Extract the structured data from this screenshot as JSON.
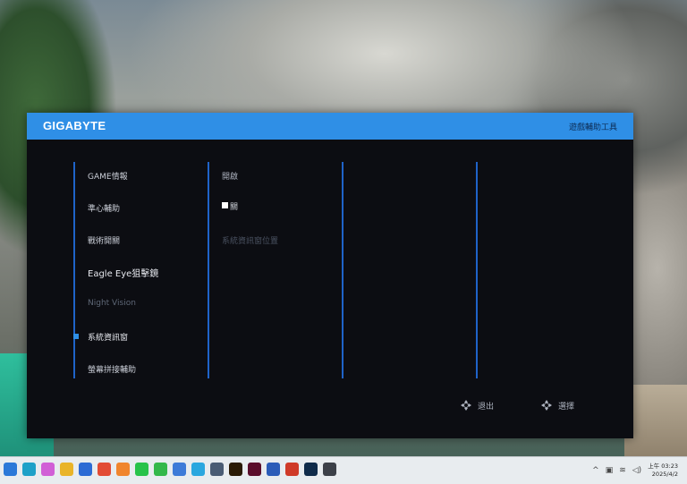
{
  "osd": {
    "brand": "GIGABYTE",
    "mode_title": "遊戲輔助工具",
    "menu": [
      {
        "label": "GAME情報",
        "state": "normal"
      },
      {
        "label": "準心輔助",
        "state": "normal"
      },
      {
        "label": "戰術開關",
        "state": "normal"
      },
      {
        "label": "Eagle Eye狙擊鏡",
        "state": "bright"
      },
      {
        "label": "Night Vision",
        "state": "disabled"
      },
      {
        "label": "系統資訊窗",
        "state": "selected"
      },
      {
        "label": "螢幕拼接輔助",
        "state": "normal"
      }
    ],
    "options": {
      "open": "開啟",
      "checkbox_label": "關",
      "position": "系統資訊窗位置"
    },
    "hints": {
      "exit": "退出",
      "select": "選擇"
    },
    "colors": {
      "header": "#2f8fe6",
      "divider": "#1f63c9",
      "panel": "#0c0d12"
    }
  },
  "taskbar": {
    "apps": [
      {
        "name": "windows-start-icon",
        "color": "#2b79d8"
      },
      {
        "name": "edge-icon",
        "color": "#1da1c8"
      },
      {
        "name": "copilot-icon",
        "color": "#d15fd6"
      },
      {
        "name": "file-explorer-icon",
        "color": "#e9b429"
      },
      {
        "name": "store-icon",
        "color": "#2c6bd4"
      },
      {
        "name": "chrome-icon",
        "color": "#e24b34"
      },
      {
        "name": "firefox-icon",
        "color": "#f0852d"
      },
      {
        "name": "line-icon",
        "color": "#27c34a"
      },
      {
        "name": "wechat-icon",
        "color": "#33b84a"
      },
      {
        "name": "snip-icon",
        "color": "#3d7bd8"
      },
      {
        "name": "photos-icon",
        "color": "#2aa7df"
      },
      {
        "name": "calculator-icon",
        "color": "#4a5c74"
      },
      {
        "name": "illustrator-icon",
        "color": "#2a1a05"
      },
      {
        "name": "indesign-icon",
        "color": "#5a0d2b"
      },
      {
        "name": "word-icon",
        "color": "#2b5cb8"
      },
      {
        "name": "powerpoint-icon",
        "color": "#cf3a28"
      },
      {
        "name": "photoshop-icon",
        "color": "#0f2b4a"
      },
      {
        "name": "printer-icon",
        "color": "#3c4048"
      }
    ],
    "tray": {
      "ampm": "上午",
      "time": "03:23",
      "date": "2025/4/2",
      "chevron": "^"
    }
  }
}
